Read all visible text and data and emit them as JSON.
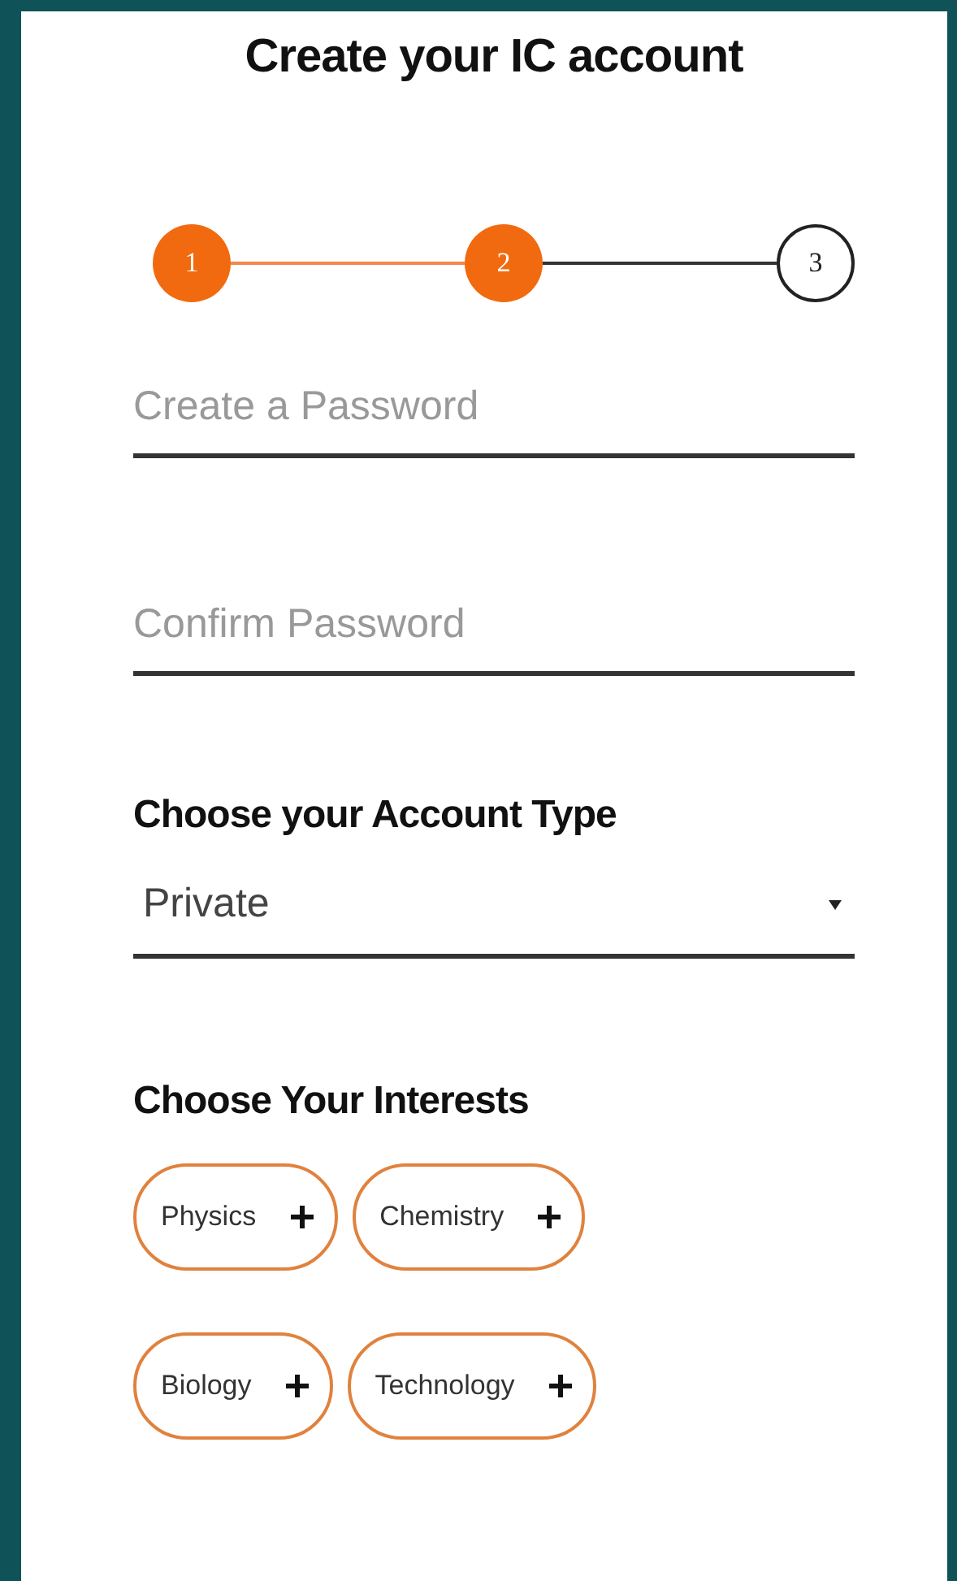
{
  "title": "Create your IC account",
  "steps": [
    {
      "label": "1",
      "completed": true
    },
    {
      "label": "2",
      "completed": true
    },
    {
      "label": "3",
      "completed": false
    }
  ],
  "password_field": {
    "placeholder": "Create a Password"
  },
  "confirm_field": {
    "placeholder": "Confirm Password"
  },
  "account_type": {
    "label": "Choose your Account Type",
    "value": "Private"
  },
  "interests": {
    "label": "Choose Your Interests",
    "chips": [
      {
        "label": "Physics"
      },
      {
        "label": "Chemistry"
      },
      {
        "label": "Biology"
      },
      {
        "label": "Technology"
      }
    ]
  }
}
